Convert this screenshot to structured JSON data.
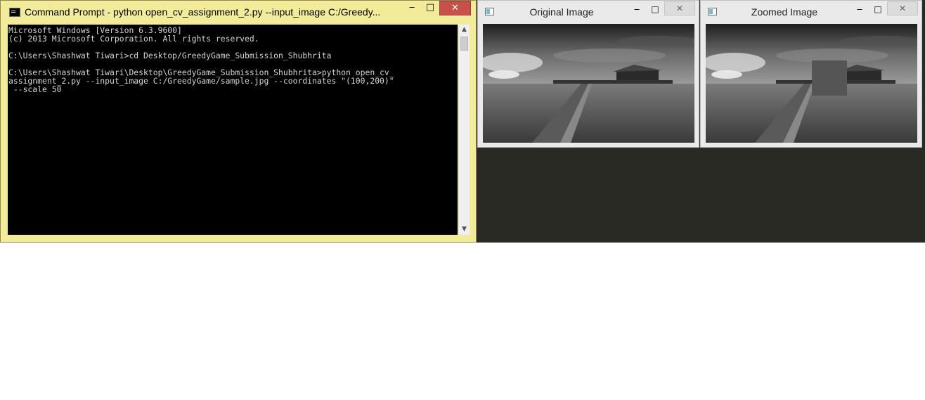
{
  "cmd": {
    "title": "Command Prompt - python  open_cv_assignment_2.py --input_image C:/Greedy...",
    "lines": [
      "Microsoft Windows [Version 6.3.9600]",
      "(c) 2013 Microsoft Corporation. All rights reserved.",
      "",
      "C:\\Users\\Shashwat Tiwari>cd Desktop/GreedyGame_Submission_Shubhrita",
      "",
      "C:\\Users\\Shashwat Tiwari\\Desktop\\GreedyGame_Submission_Shubhrita>python open_cv_",
      "assignment_2.py --input_image C:/GreedyGame/sample.jpg --coordinates \"(100,200)\"",
      " --scale 50"
    ],
    "window_controls": {
      "minimize": "‒",
      "maximize": "□",
      "close": "✕"
    }
  },
  "original_window": {
    "title": "Original Image",
    "controls": {
      "minimize": "‒",
      "maximize": "□",
      "close": "✕"
    }
  },
  "zoomed_window": {
    "title": "Zoomed Image",
    "controls": {
      "minimize": "‒",
      "maximize": "□",
      "close": "✕"
    }
  },
  "colors": {
    "cmd_frame": "#f2eb9a",
    "close_active": "#c7504a",
    "console_bg": "#000000",
    "console_fg": "#d4d4d4",
    "desktop": "#2a2a24"
  }
}
